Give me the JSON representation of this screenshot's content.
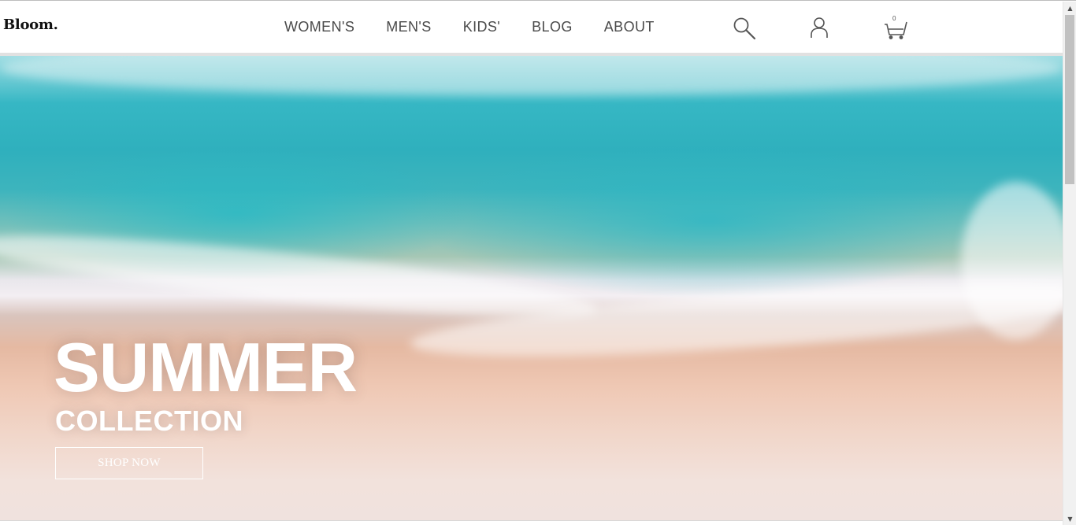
{
  "brand": {
    "logo_text": "Bloom."
  },
  "nav": {
    "items": [
      {
        "label": "WOMEN'S"
      },
      {
        "label": "MEN'S"
      },
      {
        "label": "KIDS'"
      },
      {
        "label": "BLOG"
      },
      {
        "label": "ABOUT"
      }
    ]
  },
  "header_icons": {
    "search": "search-icon",
    "account": "user-icon",
    "cart": "cart-icon",
    "cart_count": "0"
  },
  "hero": {
    "title": "SUMMER",
    "subtitle": "COLLECTION",
    "cta_label": "SHOP NOW"
  },
  "colors": {
    "text": "#4a4a4a",
    "hero_text": "#ffffff",
    "sea": "#2fb0bd",
    "sand": "#efc8b4"
  },
  "scrollbar": {
    "up": "▲",
    "down": "▼"
  }
}
